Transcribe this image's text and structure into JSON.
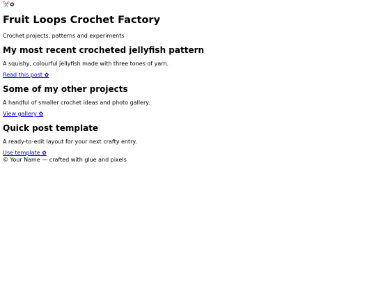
{
  "header": {
    "logo_glyphs": "✂️✿",
    "logo_icon": "scissors-flower-icon",
    "site_title": "Fruit Loops Crochet Factory",
    "tagline": "Crochet projects, patterns and experiments"
  },
  "posts": [
    {
      "title": "My most recent crocheted jellyfish pattern",
      "description": "A squishy, colourful jellyfish made with three tones of yarn.",
      "link_label": "Read this post ✿"
    },
    {
      "title": "Some of my other projects",
      "description": "A handful of smaller crochet ideas and photo gallery.",
      "link_label": "View gallery ✿"
    },
    {
      "title": "Quick post template",
      "description": "A ready-to-edit layout for your next crafty entry.",
      "link_label": "Use template ✿"
    }
  ],
  "footer": {
    "text": "© Your Name — crafted with glue and pixels"
  },
  "colors": {
    "link": "#0000ee",
    "text": "#000000",
    "background": "#ffffff"
  }
}
